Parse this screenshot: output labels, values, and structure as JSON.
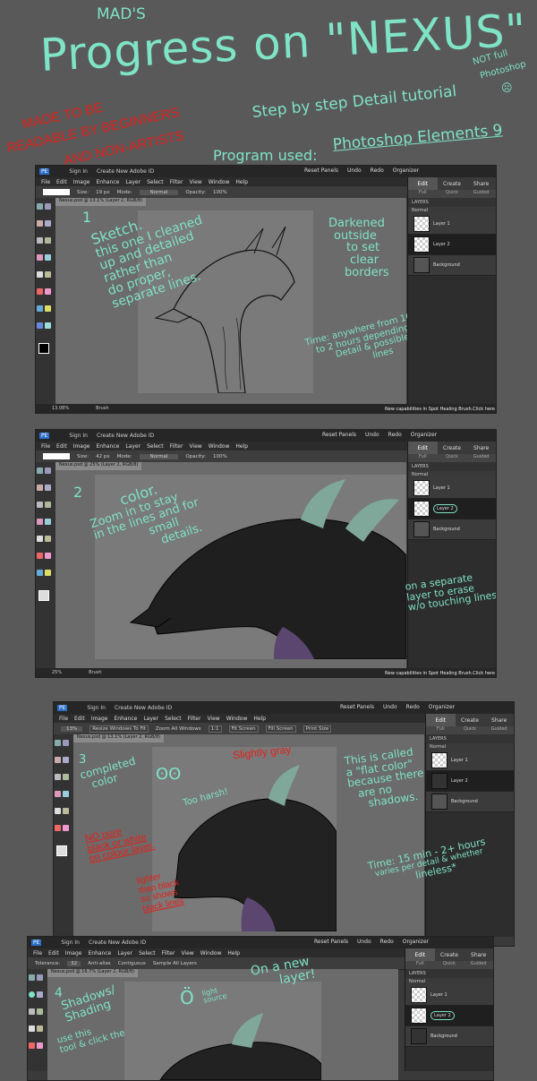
{
  "header": {
    "mads": "MAD'S",
    "title": "Progress on \"NEXUS\"",
    "subtitle": "Step by step Detail tutorial",
    "program_label": "Program used:",
    "program_value": "Photoshop Elements 9",
    "not_full_1": "NOT full",
    "not_full_2": "Photoshop",
    "beginners_1": "MADE TO BE",
    "beginners_2": "READABLE BY BEGINNERS",
    "beginners_3": "AND NON-ARTISTS"
  },
  "app": {
    "sign_in": "Sign In",
    "create_id": "Create New Adobe ID",
    "reset_panels": "Reset Panels",
    "undo": "Undo",
    "redo": "Redo",
    "organizer": "Organizer",
    "menus": [
      "File",
      "Edit",
      "Image",
      "Enhance",
      "Layer",
      "Select",
      "Filter",
      "View",
      "Window",
      "Help"
    ],
    "size_label": "Size:",
    "mode_label": "Mode:",
    "mode_value": "Normal",
    "opacity_label": "Opacity:",
    "opacity_value": "100%",
    "tabs": [
      "Edit",
      "Create",
      "Share"
    ],
    "subtabs": [
      "Full",
      "Quick",
      "Guided"
    ],
    "layers_label": "LAYERS",
    "layer1": "Layer 1",
    "layer2": "Layer 2",
    "background": "Background",
    "hint": "New capabilities in Spot Healing Brush.Click here",
    "lock": "Lock:"
  },
  "panel1": {
    "doc_tab": "Nexus.psd @ 13.1% (Layer 2, RGB/8)",
    "size": "19 px",
    "zoom": "13.08%",
    "tool": "Brush",
    "num": "1",
    "note_sketch": [
      "Sketch.",
      "this one I cleaned",
      "up and detailed",
      "rather than",
      "do proper,",
      "separate lines."
    ],
    "note_dark": [
      "Darkened",
      "outside",
      "to set",
      "clear",
      "borders"
    ],
    "note_time": [
      "Time: anywhere from 10 minutes",
      "to 2 hours depending on",
      "Detail & possible separate",
      "lines"
    ]
  },
  "panel2": {
    "doc_tab": "Nexus.psd @ 25% (Layer 2, RGB/8)",
    "size": "42 px",
    "zoom": "25%",
    "tool": "Brush",
    "num": "2",
    "note_color": [
      "color.",
      "Zoom in to stay",
      "in the lines and for",
      "small",
      "details."
    ],
    "note_layer": [
      "on a separate",
      "layer to erase",
      "w/o touching lines"
    ]
  },
  "panel3": {
    "doc_tab": "Nexus.psd @ 13.1% (Layer 2, RGB/8)",
    "zoom": "13%",
    "opts": [
      "Resize Windows To Fit",
      "Zoom All Windows",
      "1:1",
      "Fit Screen",
      "Fill Screen",
      "Print Size"
    ],
    "num": "3",
    "note_completed": [
      "completed",
      "color"
    ],
    "note_harsh": "Too harsh!",
    "note_gray": "Slightly gray",
    "note_flat": [
      "This is called",
      "a \"flat color\"",
      "because there",
      "are no",
      "shadows."
    ],
    "note_nopure": [
      "NO pure",
      "black or white",
      "on colour layer."
    ],
    "note_lighter": [
      "lighter",
      "than black",
      "so shows",
      "black lines"
    ],
    "note_time": [
      "Time: 15 min - 2+ hours",
      "varies per detail & whether",
      "lineless*"
    ]
  },
  "panel4": {
    "doc_tab": "Nexus.psd @ 16.7% (Layer 2, RGB/8)",
    "opts": [
      "Tolerance:",
      "Anti-alias",
      "Contiguous",
      "Sample All Layers"
    ],
    "tolerance": "32",
    "num": "4",
    "note_shadows": [
      "Shadows/",
      "Shading"
    ],
    "note_new": [
      "On a new",
      "layer!"
    ],
    "note_light": [
      "light",
      "source"
    ],
    "note_use": [
      "use this",
      "tool & click the"
    ]
  },
  "colors": {
    "accent": "#7fe3c6",
    "red": "#e0221c",
    "bg": "#595959",
    "dragon_horn": "#7fa89a",
    "dragon_belly": "#5b4670"
  }
}
